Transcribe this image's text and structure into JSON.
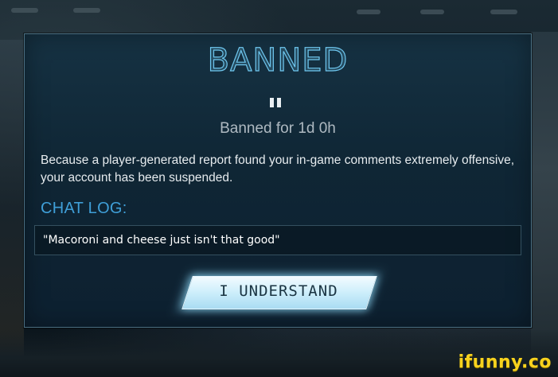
{
  "dialog": {
    "title": "BANNED",
    "status_icon": "pause-icon",
    "duration": "Banned for 1d 0h",
    "reason": "Because a player-generated report found your in-game comments extremely offensive, your account has been suspended.",
    "chat_log_label": "CHAT LOG:",
    "chat_log_entry": "\"Macoroni and cheese just isn't that good\"",
    "confirm_button": "I UNDERSTAND"
  },
  "colors": {
    "accent": "#6ec6ee",
    "chat_label": "#3f9fd8",
    "panel": "#0f2635",
    "button": "#cdeefb"
  },
  "watermark": {
    "text": "ifunny.co"
  }
}
